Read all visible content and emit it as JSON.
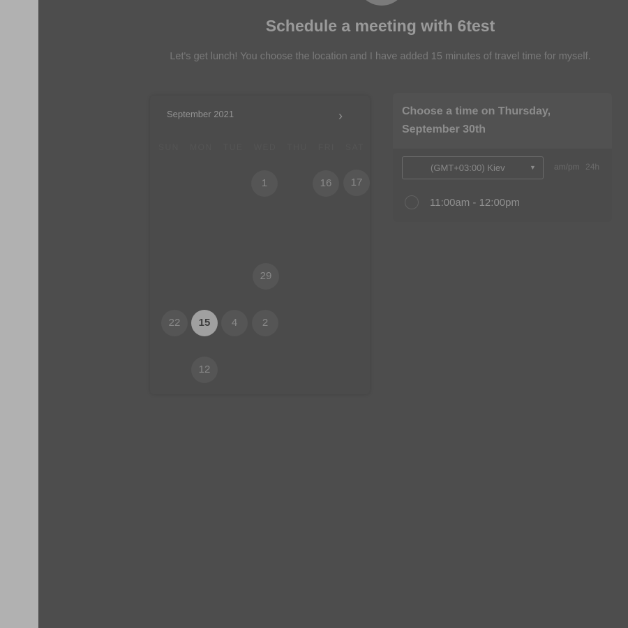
{
  "header": {
    "title": "Schedule a meeting with 6test",
    "subtitle": "Let's get lunch! You choose the location and I have added 15 minutes of travel time for myself."
  },
  "calendar": {
    "month_label": "September 2021",
    "next_icon": "chevron-right-icon",
    "weekdays": [
      "SUN",
      "MON",
      "TUE",
      "WED",
      "THU",
      "FRI",
      "SAT"
    ],
    "days": [
      {
        "label": "1",
        "state": "available"
      },
      {
        "label": "16",
        "state": "available"
      },
      {
        "label": "17",
        "state": "available"
      },
      {
        "label": "29",
        "state": "available"
      },
      {
        "label": "22",
        "state": "available"
      },
      {
        "label": "15",
        "state": "selected"
      },
      {
        "label": "4",
        "state": "available"
      },
      {
        "label": "2",
        "state": "available"
      },
      {
        "label": "12",
        "state": "available"
      }
    ]
  },
  "time_panel": {
    "title": "Choose a time on Thursday, September 30th",
    "timezone": "(GMT+03:00) Kiev",
    "format_options": [
      "am/pm",
      "24h"
    ],
    "slots": [
      {
        "label": "11:00am - 12:00pm"
      }
    ]
  },
  "colors": {
    "overlay": "#4d4d4d",
    "left_strip": "#b1b1b1",
    "selected_day": "#a0a0a0"
  }
}
